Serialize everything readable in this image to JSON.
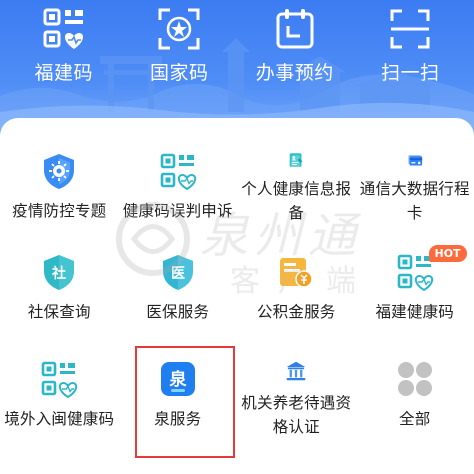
{
  "top_bar": {
    "items": [
      {
        "label": "福建码",
        "icon": "qr-heart-icon"
      },
      {
        "label": "国家码",
        "icon": "qr-badge-icon"
      },
      {
        "label": "办事预约",
        "icon": "calendar-icon"
      },
      {
        "label": "扫一扫",
        "icon": "scan-icon"
      }
    ]
  },
  "services": [
    {
      "label": "疫情防控专题",
      "icon": "shield-virus-icon"
    },
    {
      "label": "健康码误判申诉",
      "icon": "qr-heart-icon"
    },
    {
      "label": "个人健康信息报备",
      "icon": "id-card-icon"
    },
    {
      "label": "通信大数据行程卡",
      "icon": "travel-card-icon"
    },
    {
      "label": "社保查询",
      "icon": "social-security-icon",
      "icon_text": "社"
    },
    {
      "label": "医保服务",
      "icon": "medical-insurance-icon",
      "icon_text": "医"
    },
    {
      "label": "公积金服务",
      "icon": "housing-fund-icon"
    },
    {
      "label": "福建健康码",
      "icon": "qr-heart-icon",
      "badge": "HOT"
    },
    {
      "label": "境外入闽健康码",
      "icon": "qr-heart-icon"
    },
    {
      "label": "泉服务",
      "icon": "quan-app-icon",
      "icon_text": "泉"
    },
    {
      "label": "机关养老待遇资格认证",
      "icon": "institution-icon"
    },
    {
      "label": "全部",
      "icon": "all-grid-icon"
    }
  ],
  "watermark": {
    "line1": "泉州通",
    "line2": "客户端"
  },
  "colors": {
    "banner": "#4f8df6",
    "icon_blue": "#2f80f5",
    "icon_teal": "#25b7c9",
    "highlight_border": "#e43a3a",
    "hot_badge": "#ff6a3d"
  }
}
